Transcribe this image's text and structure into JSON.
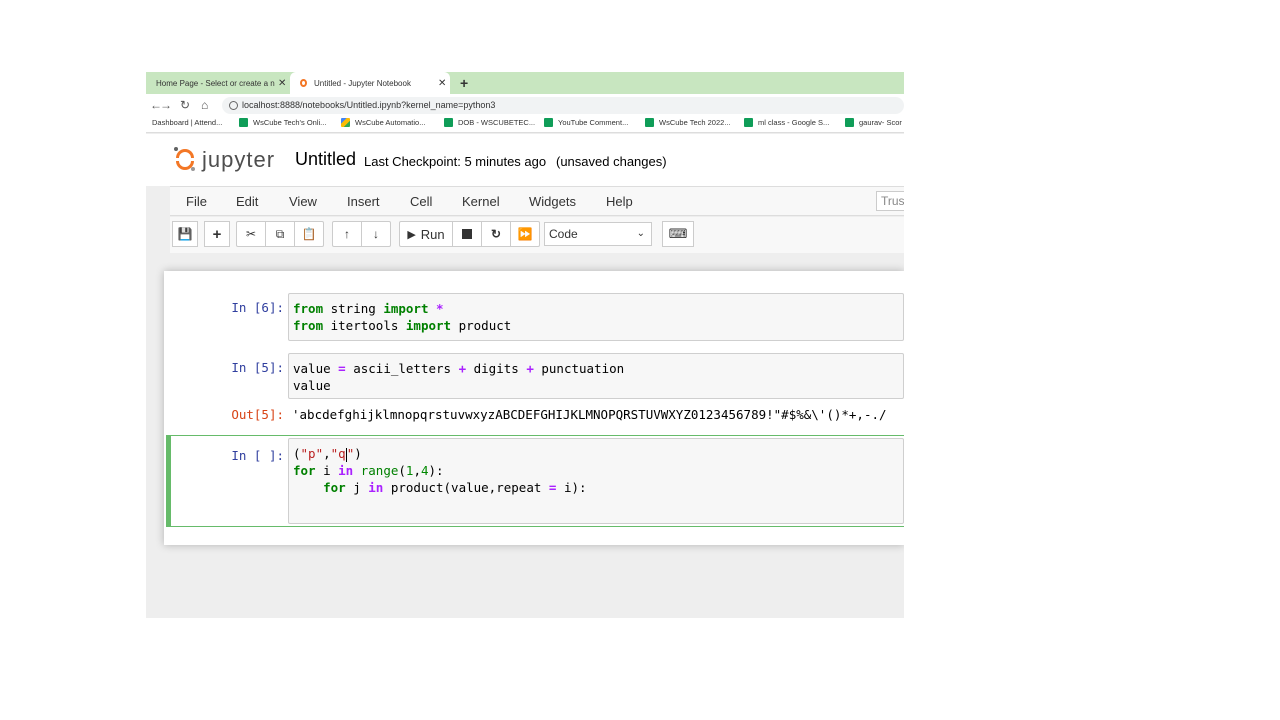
{
  "browser": {
    "tabs": [
      {
        "title": "Home Page - Select or create a n",
        "close": "✕"
      },
      {
        "title": "Untitled - Jupyter Notebook",
        "close": "✕"
      }
    ],
    "new_tab": "+",
    "url": "localhost:8888/notebooks/Untitled.ipynb?kernel_name=python3",
    "bookmarks": [
      {
        "label": "Dashboard | Attend...",
        "icon": "none"
      },
      {
        "label": "WsCube Tech's Onli...",
        "icon": "sheets-icon"
      },
      {
        "label": "WsCube Automatio...",
        "icon": "drive-icon"
      },
      {
        "label": "DOB - WSCUBETEC...",
        "icon": "sheets-icon"
      },
      {
        "label": "YouTube Comment...",
        "icon": "sheets-icon"
      },
      {
        "label": "WsCube Tech 2022...",
        "icon": "sheets-icon"
      },
      {
        "label": "ml class - Google S...",
        "icon": "sheets-icon"
      },
      {
        "label": "gaurav- Scor",
        "icon": "sheets-icon"
      }
    ]
  },
  "jupyter": {
    "logo_text": "jupyter",
    "notebook_title": "Untitled",
    "checkpoint": "Last Checkpoint: 5 minutes ago",
    "unsaved": "(unsaved changes)",
    "menu": [
      "File",
      "Edit",
      "View",
      "Insert",
      "Cell",
      "Kernel",
      "Widgets",
      "Help"
    ],
    "trusted": "Trus",
    "toolbar": {
      "run_label": "Run",
      "cell_type": "Code"
    }
  },
  "cells": [
    {
      "prompt": "In [6]:",
      "lines": [
        [
          {
            "t": "from",
            "c": "kw"
          },
          {
            "t": " string ",
            "c": ""
          },
          {
            "t": "import",
            "c": "kw"
          },
          {
            "t": " ",
            "c": ""
          },
          {
            "t": "*",
            "c": "op"
          }
        ],
        [
          {
            "t": "from",
            "c": "kw"
          },
          {
            "t": " itertools ",
            "c": ""
          },
          {
            "t": "import",
            "c": "kw"
          },
          {
            "t": " product",
            "c": ""
          }
        ]
      ]
    },
    {
      "prompt": "In [5]:",
      "lines": [
        [
          {
            "t": "value ",
            "c": ""
          },
          {
            "t": "=",
            "c": "op"
          },
          {
            "t": " ascii_letters ",
            "c": ""
          },
          {
            "t": "+",
            "c": "op"
          },
          {
            "t": " digits ",
            "c": ""
          },
          {
            "t": "+",
            "c": "op"
          },
          {
            "t": " punctuation",
            "c": ""
          }
        ],
        [
          {
            "t": "value",
            "c": ""
          }
        ]
      ],
      "out_prompt": "Out[5]:",
      "output": "'abcdefghijklmnopqrstuvwxyzABCDEFGHIJKLMNOPQRSTUVWXYZ0123456789!\"#$%&\\'()*+,-./"
    },
    {
      "prompt": "In [ ]:",
      "lines": [
        [
          {
            "t": "(",
            "c": ""
          },
          {
            "t": "\"p\"",
            "c": "str"
          },
          {
            "t": ",",
            "c": ""
          },
          {
            "t": "\"q",
            "c": "str"
          },
          {
            "t": "|",
            "c": "cursor"
          },
          {
            "t": "\"",
            "c": "str"
          },
          {
            "t": ")",
            "c": ""
          }
        ],
        [
          {
            "t": "for",
            "c": "kw"
          },
          {
            "t": " i ",
            "c": ""
          },
          {
            "t": "in",
            "c": "op"
          },
          {
            "t": " ",
            "c": ""
          },
          {
            "t": "range",
            "c": "kw-n"
          },
          {
            "t": "(",
            "c": ""
          },
          {
            "t": "1",
            "c": "num"
          },
          {
            "t": ",",
            "c": ""
          },
          {
            "t": "4",
            "c": "num"
          },
          {
            "t": "):",
            "c": ""
          }
        ],
        [
          {
            "t": "    ",
            "c": ""
          },
          {
            "t": "for",
            "c": "kw"
          },
          {
            "t": " j ",
            "c": ""
          },
          {
            "t": "in",
            "c": "op"
          },
          {
            "t": " product(value,repeat ",
            "c": ""
          },
          {
            "t": "=",
            "c": "op"
          },
          {
            "t": " i):",
            "c": ""
          }
        ]
      ]
    }
  ]
}
